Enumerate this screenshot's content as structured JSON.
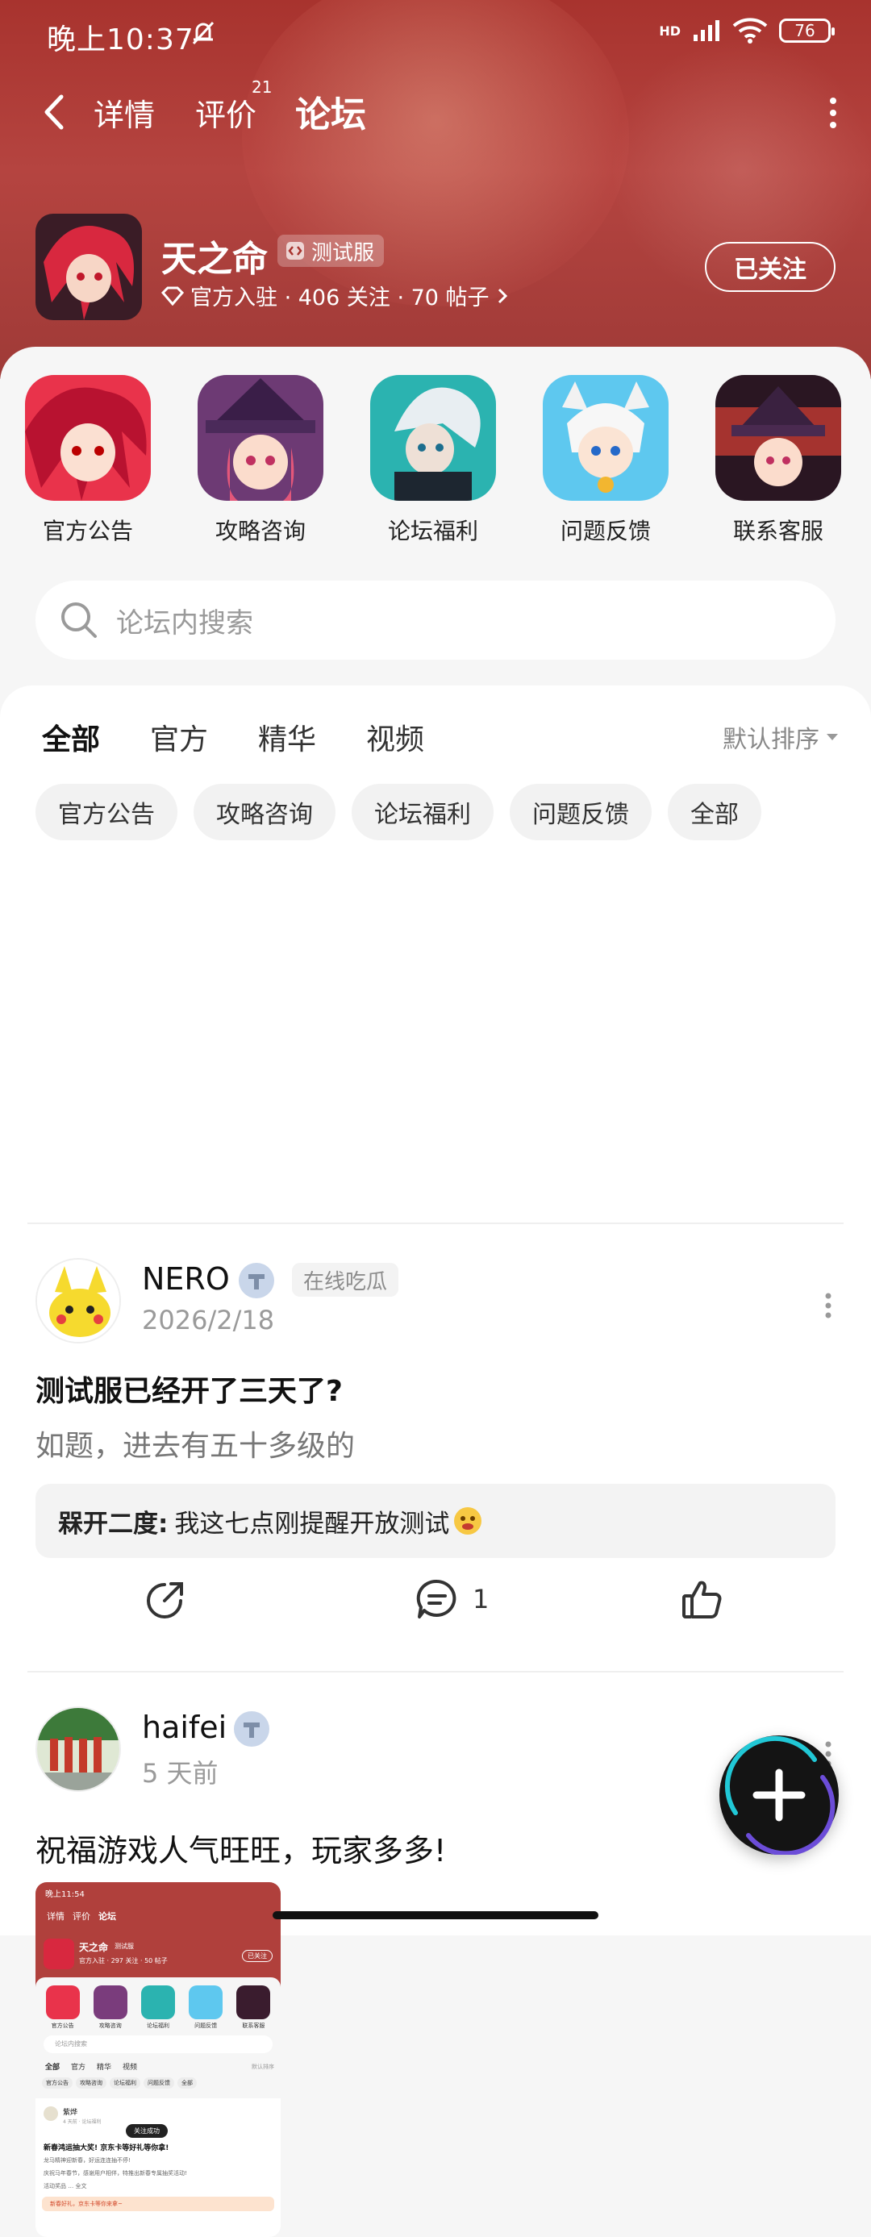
{
  "status_bar": {
    "time": "晚上10:37",
    "network": "HD",
    "battery": "76"
  },
  "nav": {
    "tabs": [
      {
        "label": "详情"
      },
      {
        "label": "评价",
        "count": "21"
      },
      {
        "label": "论坛"
      }
    ],
    "active_tab": "论坛"
  },
  "app": {
    "name": "天之命",
    "tag": "测试服",
    "meta": "官方入驻 · 406 关注 · 70 帖子",
    "follow_label": "已关注"
  },
  "boards": [
    {
      "label": "官方公告"
    },
    {
      "label": "攻略咨询"
    },
    {
      "label": "论坛福利"
    },
    {
      "label": "问题反馈"
    },
    {
      "label": "联系客服"
    }
  ],
  "search": {
    "placeholder": "论坛内搜索"
  },
  "feed_tabs": [
    "全部",
    "官方",
    "精华",
    "视频"
  ],
  "sort_label": "默认排序",
  "chips": [
    "官方公告",
    "攻略咨询",
    "论坛福利",
    "问题反馈",
    "全部"
  ],
  "posts": [
    {
      "username": "NERO",
      "flag": "在线吃瓜",
      "date": "2026/2/18",
      "title": "测试服已经开了三天了?",
      "body": "如题，进去有五十多级的",
      "comment_author": "槑开二度:",
      "comment_text": "我这七点刚提醒开放测试",
      "comment_count": "1"
    },
    {
      "username": "haifei",
      "date": "5 天前",
      "text": "祝福游戏人气旺旺，玩家多多!"
    }
  ],
  "screenshot": {
    "time": "晚上11:54",
    "tabs": [
      "详情",
      "评价",
      "论坛"
    ],
    "app_name": "天之命",
    "app_tag": "测试服",
    "app_meta": "官方入驻 · 297 关注 · 50 帖子",
    "follow": "已关注",
    "boards": [
      "官方公告",
      "攻略咨询",
      "论坛福利",
      "问题反馈",
      "联系客服"
    ],
    "search": "论坛内搜索",
    "feed_tabs": [
      "全部",
      "官方",
      "精华",
      "视频"
    ],
    "sort": "默认排序",
    "chips": [
      "官方公告",
      "攻略咨询",
      "论坛福利",
      "问题反馈",
      "全部"
    ],
    "poster": "紫烨",
    "post_meta": "4 天前 · 论坛福利",
    "toast": "关注成功",
    "post_title": "新春鸿运抽大奖! 京东卡等好礼等你拿!",
    "post_line1": "龙马精神迎新春，好运连连抽不停!",
    "post_line2": "庆祝马年春节，感谢用户相伴，特推出新春专属抽奖活动!",
    "post_line3": "活动奖品 … 全文",
    "post_banner": "新春好礼，京东卡等你来拿~"
  },
  "colors": {
    "hero": "#a8332e",
    "accent": "#22d3c5",
    "panel": "#f6f6f6"
  }
}
